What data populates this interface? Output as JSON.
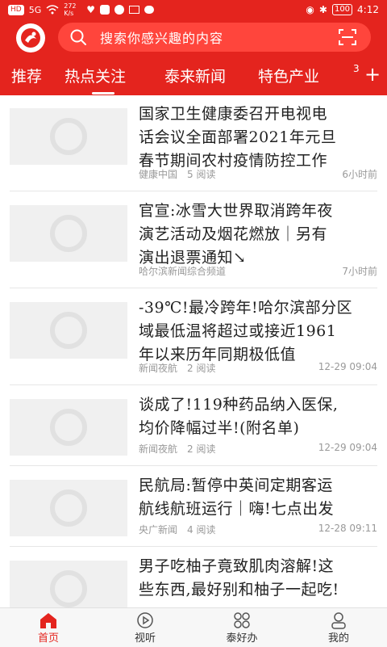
{
  "status_bar": {
    "badges": [
      "HD",
      "5G"
    ],
    "net_speed": "272 K/s",
    "battery": "100",
    "time": "4:12"
  },
  "search": {
    "placeholder": "搜索你感兴趣的内容"
  },
  "tabs": [
    {
      "label": "推荐"
    },
    {
      "label": "热点关注",
      "active": true
    },
    {
      "label": "泰来新闻"
    },
    {
      "label": "特色产业"
    },
    {
      "label": "3"
    }
  ],
  "feed": [
    {
      "title_lines": [
        "国家卫生健康委召开电视电",
        "话会议全面部署2021年元旦",
        "春节期间农村疫情防控工作"
      ],
      "source": "健康中国",
      "reads": "5 阅读",
      "time": "6小时前"
    },
    {
      "title_lines": [
        "官宣:冰雪大世界取消跨年夜",
        "演艺活动及烟花燃放｜另有",
        "演出退票通知↘"
      ],
      "source": "哈尔滨新闻综合频道",
      "reads": "",
      "time": "7小时前"
    },
    {
      "title_lines": [
        "-39℃!最冷跨年!哈尔滨部分区",
        "域最低温将超过或接近1961",
        "年以来历年同期极低值"
      ],
      "source": "新闻夜航",
      "reads": "2 阅读",
      "time": "12-29 09:04"
    },
    {
      "title_lines": [
        "谈成了!119种药品纳入医保,",
        "均价降幅过半!(附名单)"
      ],
      "source": "新闻夜航",
      "reads": "2 阅读",
      "time": "12-29 09:04"
    },
    {
      "title_lines": [
        "民航局:暂停中英间定期客运",
        "航线航班运行｜嗨!七点出发"
      ],
      "source": "央广新闻",
      "reads": "4 阅读",
      "time": "12-28 09:11"
    },
    {
      "title_lines": [
        "男子吃柚子竟致肌肉溶解!这",
        "些东西,最好别和柚子一起吃!"
      ],
      "source": "",
      "reads": "",
      "time": ""
    }
  ],
  "bottom_nav": [
    {
      "label": "首页",
      "icon": "home-icon",
      "active": true
    },
    {
      "label": "视听",
      "icon": "play-icon"
    },
    {
      "label": "泰好办",
      "icon": "grid-icon"
    },
    {
      "label": "我的",
      "icon": "user-icon"
    }
  ],
  "colors": {
    "brand_red": "#e4241e",
    "search_bg": "#ff453c",
    "meta_gray": "#999999"
  }
}
